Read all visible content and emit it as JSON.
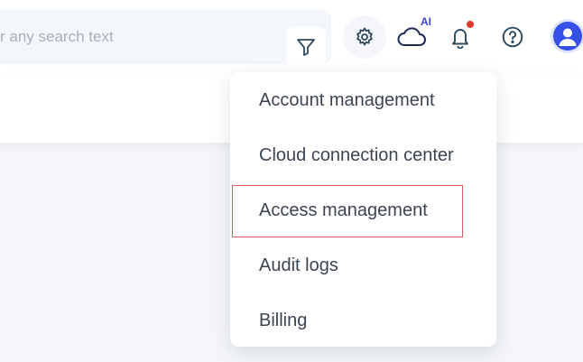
{
  "header": {
    "search": {
      "placeholder": "r any search text"
    },
    "ai_badge": "AI"
  },
  "icons": {
    "filter": "filter-icon",
    "settings": "gear-icon",
    "cloud": "cloud-icon",
    "notifications": "bell-icon",
    "help": "help-icon",
    "user": "user-avatar-icon"
  },
  "settings_menu": {
    "items": [
      {
        "label": "Account management"
      },
      {
        "label": "Cloud connection center"
      },
      {
        "label": "Access management",
        "highlighted": true
      },
      {
        "label": "Audit logs"
      },
      {
        "label": "Billing"
      }
    ]
  },
  "colors": {
    "accent": "#3550e8",
    "notification_dot": "#e5392f",
    "highlight_border": "#dc5b5b",
    "icon": "#2f4a5e"
  }
}
